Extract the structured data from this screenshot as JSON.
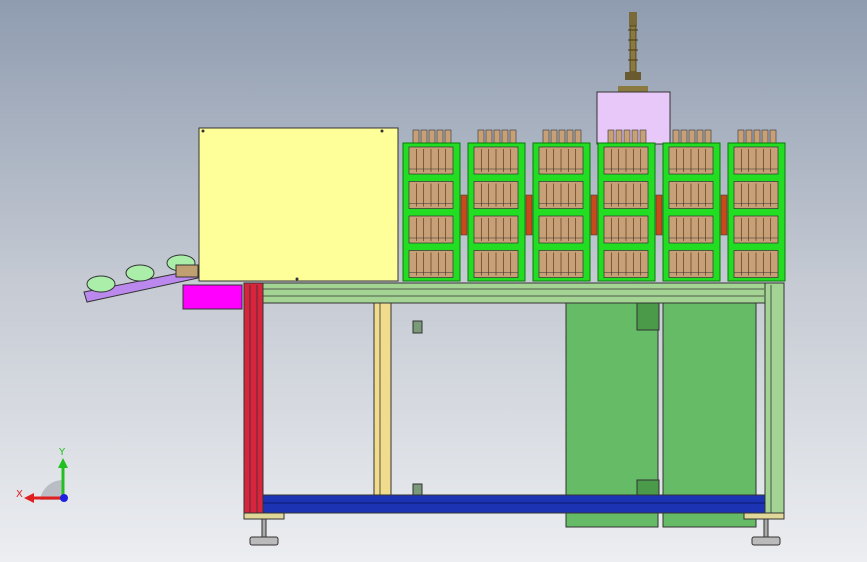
{
  "viewport": {
    "background_top": "#8f9cb0",
    "background_bottom": "#eceef1"
  },
  "machine": {
    "colors": {
      "cabinet": "#ffff99",
      "modules": "#22dd22",
      "module_outline": "#0a7a0a",
      "cells": "#c8a078",
      "frame_left_post": "#d8243c",
      "frame_mid_post": "#f0dc8c",
      "frame_beams": "#a4d494",
      "bottom_beam": "#1c34b4",
      "cabinet_lower": "#66bb66",
      "signal_tower_box": "#e8c8f8",
      "magenta_block": "#ff00ff",
      "conveyor": "#bb88ee",
      "housing": "#aaeeaa"
    },
    "module_columns": 6,
    "module_rows": 4,
    "conveyor_items": 3
  },
  "triad": {
    "x_label": "X",
    "y_label": "Y",
    "x_color": "#e02020",
    "y_color": "#20c020",
    "z_color": "#2020e0"
  }
}
